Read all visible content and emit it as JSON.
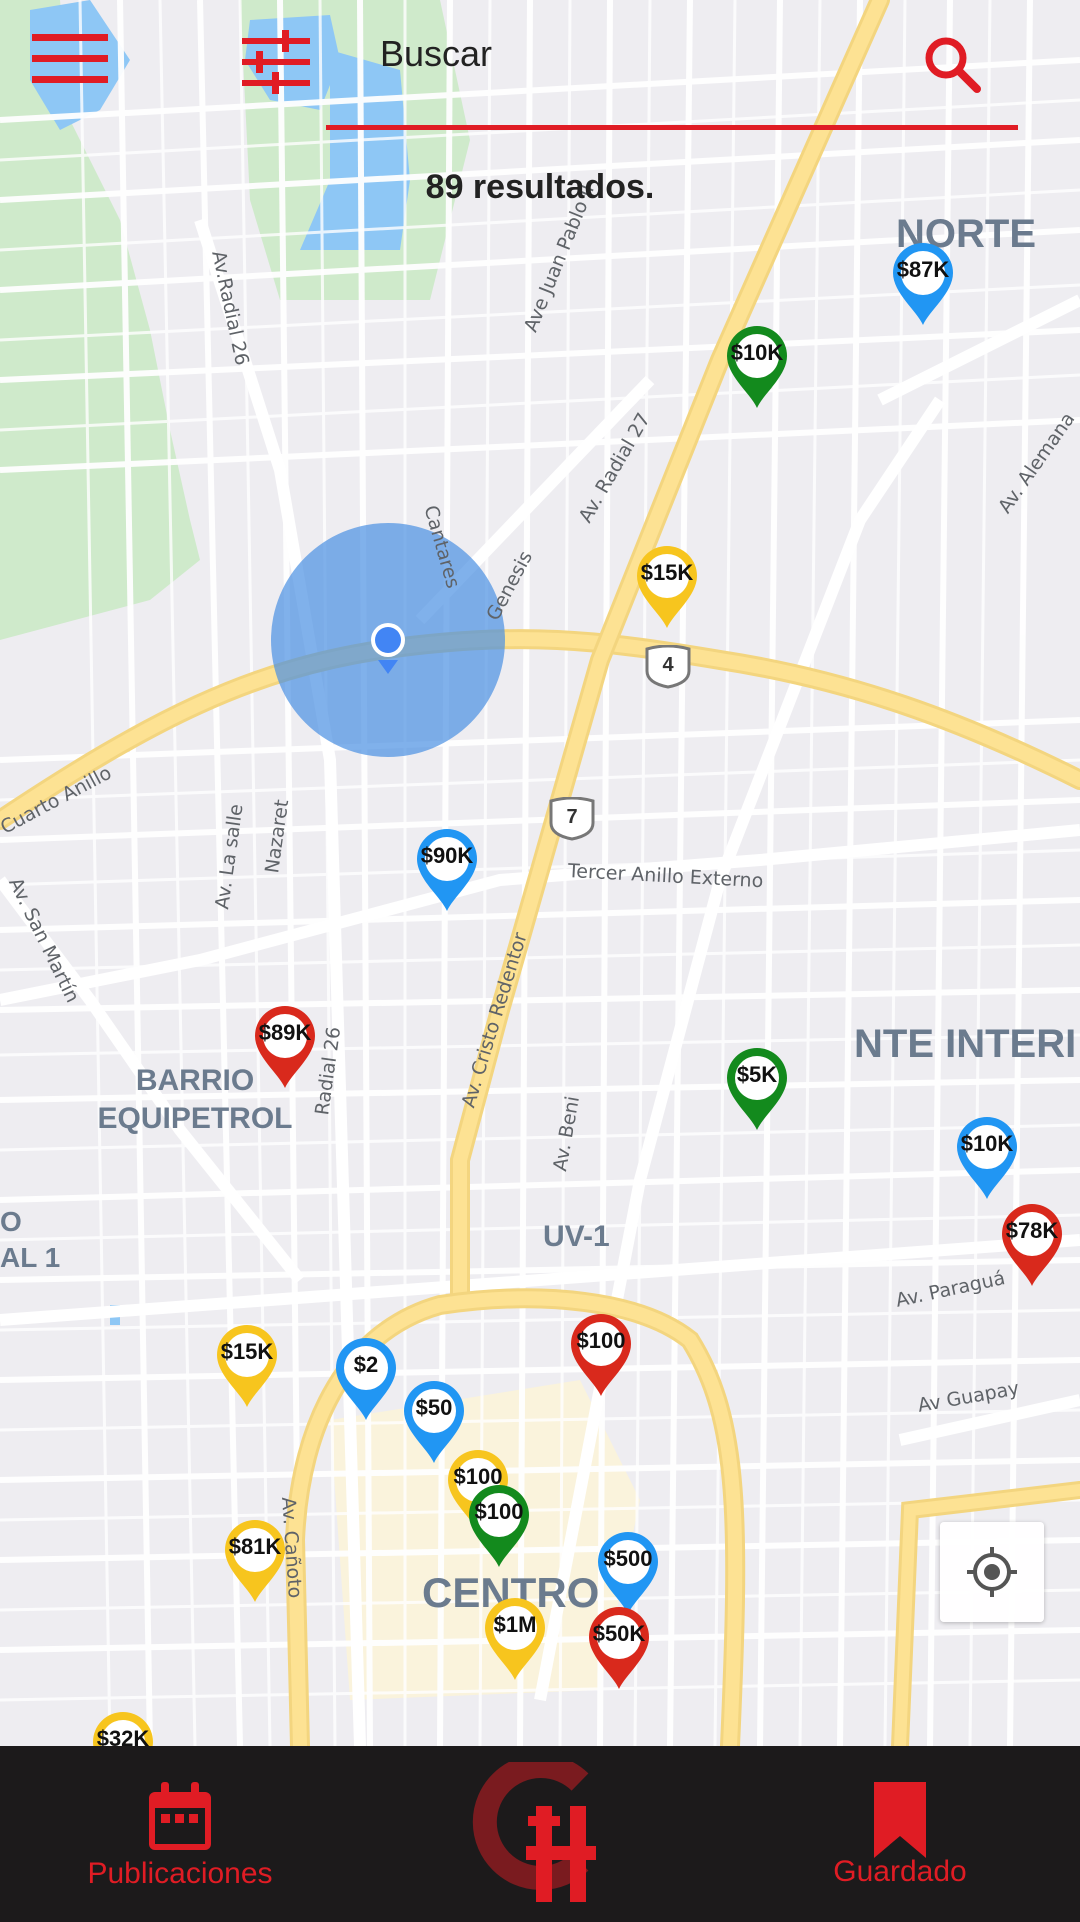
{
  "header": {
    "search_placeholder": "Buscar",
    "results_count": "89",
    "results_suffix": " resultados.",
    "accent_color": "#e01c24",
    "menu_icon": "hamburger-menu-icon",
    "filter_icon": "filter-sliders-icon",
    "search_icon": "magnifier-icon"
  },
  "map": {
    "area_labels": {
      "norte": "NORTE",
      "nte_inter": "NTE INTERI",
      "barrio": "BARRIO",
      "equipetrol": "EQUIPETROL",
      "uv1": "UV-1",
      "centro": "CENTRO",
      "edge_o": "O",
      "edge_al1": "AL 1"
    },
    "road_labels": {
      "radial26_top": "Av.Radial 26",
      "juan_pablo": "Ave Juan Pablo II",
      "radial27": "Av. Radial 27",
      "cantares": "Cantares",
      "genesis": "Genesis",
      "alemana": "Av. Alemana",
      "cuarto_anillo": "Cuarto Anillo",
      "la_salle": "Av. La salle",
      "nazaret": "Nazaret",
      "san_martin": "Av. San Martín",
      "tercer_anillo": "Tercer Anillo Externo",
      "cristo_redentor": "Av. Cristo Redentor",
      "radial26_mid": "Radial 26",
      "beni": "Av. Beni",
      "paragua": "Av. Paraguá",
      "guapay": "Av Guapay",
      "canoto": "Av. Cañoto"
    },
    "shields": [
      "4",
      "7"
    ],
    "pins": [
      {
        "price": "$87K",
        "color": "#2196f3"
      },
      {
        "price": "$10K",
        "color": "#138a1d"
      },
      {
        "price": "$15K",
        "color": "#f7c51e"
      },
      {
        "price": "$90K",
        "color": "#2196f3"
      },
      {
        "price": "$89K",
        "color": "#d9291c"
      },
      {
        "price": "$5K",
        "color": "#138a1d"
      },
      {
        "price": "$10K",
        "color": "#2196f3"
      },
      {
        "price": "$78K",
        "color": "#d9291c"
      },
      {
        "price": "$15K",
        "color": "#f7c51e"
      },
      {
        "price": "$2",
        "color": "#2196f3"
      },
      {
        "price": "$100",
        "color": "#d9291c"
      },
      {
        "price": "$50",
        "color": "#2196f3"
      },
      {
        "price": "$100",
        "color": "#f7c51e"
      },
      {
        "price": "$100",
        "color": "#138a1d"
      },
      {
        "price": "$81K",
        "color": "#f7c51e"
      },
      {
        "price": "$500",
        "color": "#2196f3"
      },
      {
        "price": "$1M",
        "color": "#f7c51e"
      },
      {
        "price": "$50K",
        "color": "#d9291c"
      },
      {
        "price": "$32K",
        "color": "#f7c51e"
      }
    ],
    "locate_icon": "my-location-crosshair-icon"
  },
  "bottom_nav": {
    "publicaciones": "Publicaciones",
    "guardado": "Guardado",
    "logo_icon": "ch-logo-icon"
  }
}
